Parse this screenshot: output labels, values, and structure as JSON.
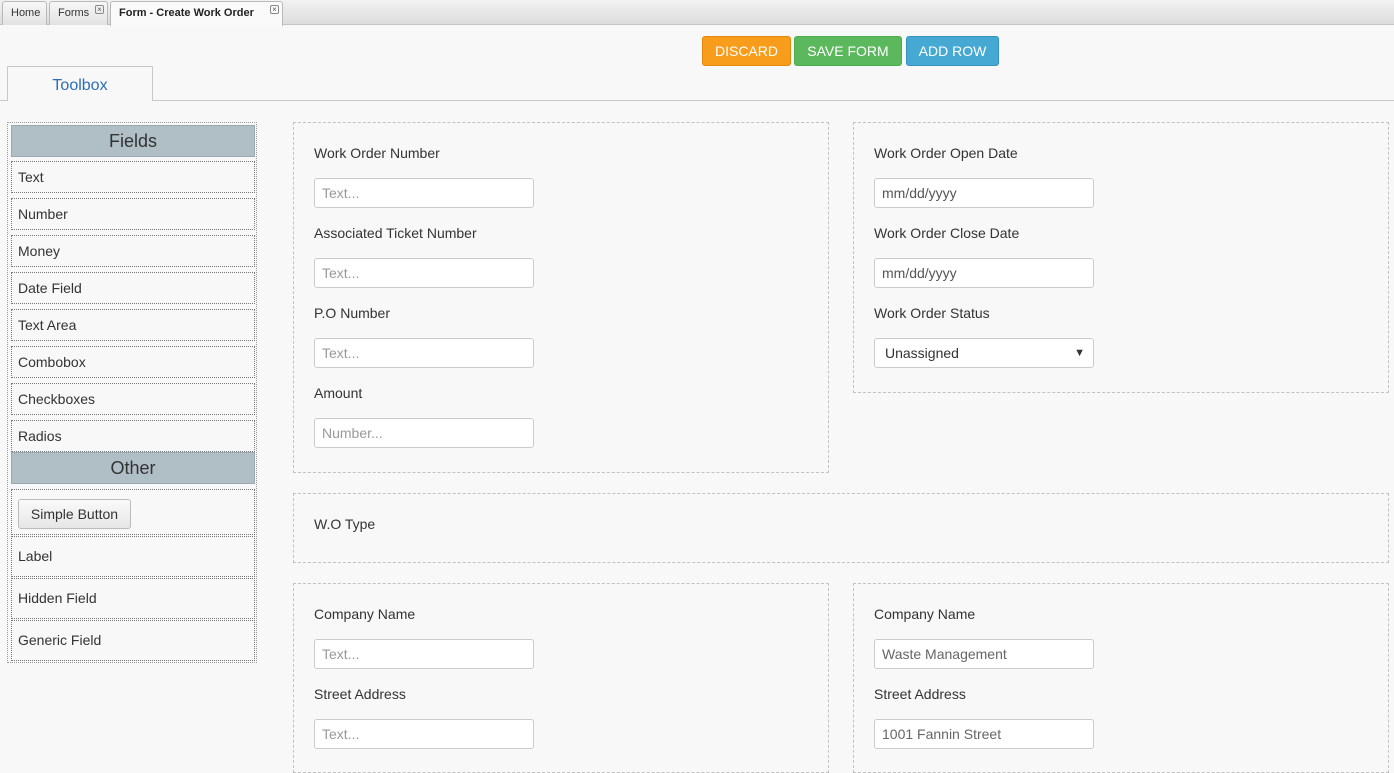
{
  "tabs": [
    {
      "label": "Home",
      "closable": false
    },
    {
      "label": "Forms",
      "closable": true
    },
    {
      "label": "Form - Create Work Order",
      "closable": true,
      "active": true
    }
  ],
  "actions": {
    "discard": "DISCARD",
    "save_form": "SAVE FORM",
    "add_row": "ADD ROW"
  },
  "toolbox": {
    "tab_label": "Toolbox",
    "fields_header": "Fields",
    "fields": [
      "Text",
      "Number",
      "Money",
      "Date Field",
      "Text Area",
      "Combobox",
      "Checkboxes",
      "Radios"
    ],
    "other_header": "Other",
    "simple_button": "Simple Button",
    "other": [
      "Label",
      "Hidden Field",
      "Generic Field"
    ]
  },
  "form": {
    "left": {
      "work_order_number": {
        "label": "Work Order Number",
        "placeholder": "Text..."
      },
      "ticket_number": {
        "label": "Associated Ticket Number",
        "placeholder": "Text..."
      },
      "po_number": {
        "label": "P.O Number",
        "placeholder": "Text..."
      },
      "amount": {
        "label": "Amount",
        "placeholder": "Number..."
      }
    },
    "right": {
      "open_date": {
        "label": "Work Order Open Date",
        "placeholder": "mm/dd/yyyy"
      },
      "close_date": {
        "label": "Work Order Close Date",
        "placeholder": "mm/dd/yyyy"
      },
      "status": {
        "label": "Work Order Status",
        "value": "Unassigned"
      }
    },
    "wo_type": {
      "label": "W.O Type"
    },
    "company_left": {
      "company_name": {
        "label": "Company Name",
        "placeholder": "Text..."
      },
      "street_address": {
        "label": "Street Address",
        "placeholder": "Text..."
      }
    },
    "company_right": {
      "company_name": {
        "label": "Company Name",
        "placeholder": "Waste Management"
      },
      "street_address": {
        "label": "Street Address",
        "placeholder": "1001 Fannin Street"
      }
    }
  },
  "colors": {
    "discard": "#f89c1c",
    "save": "#5cb85c",
    "add_row": "#46a9d4",
    "toolbox_header": "#b0bec6",
    "toolbox_tab_text": "#2a6ebb"
  }
}
